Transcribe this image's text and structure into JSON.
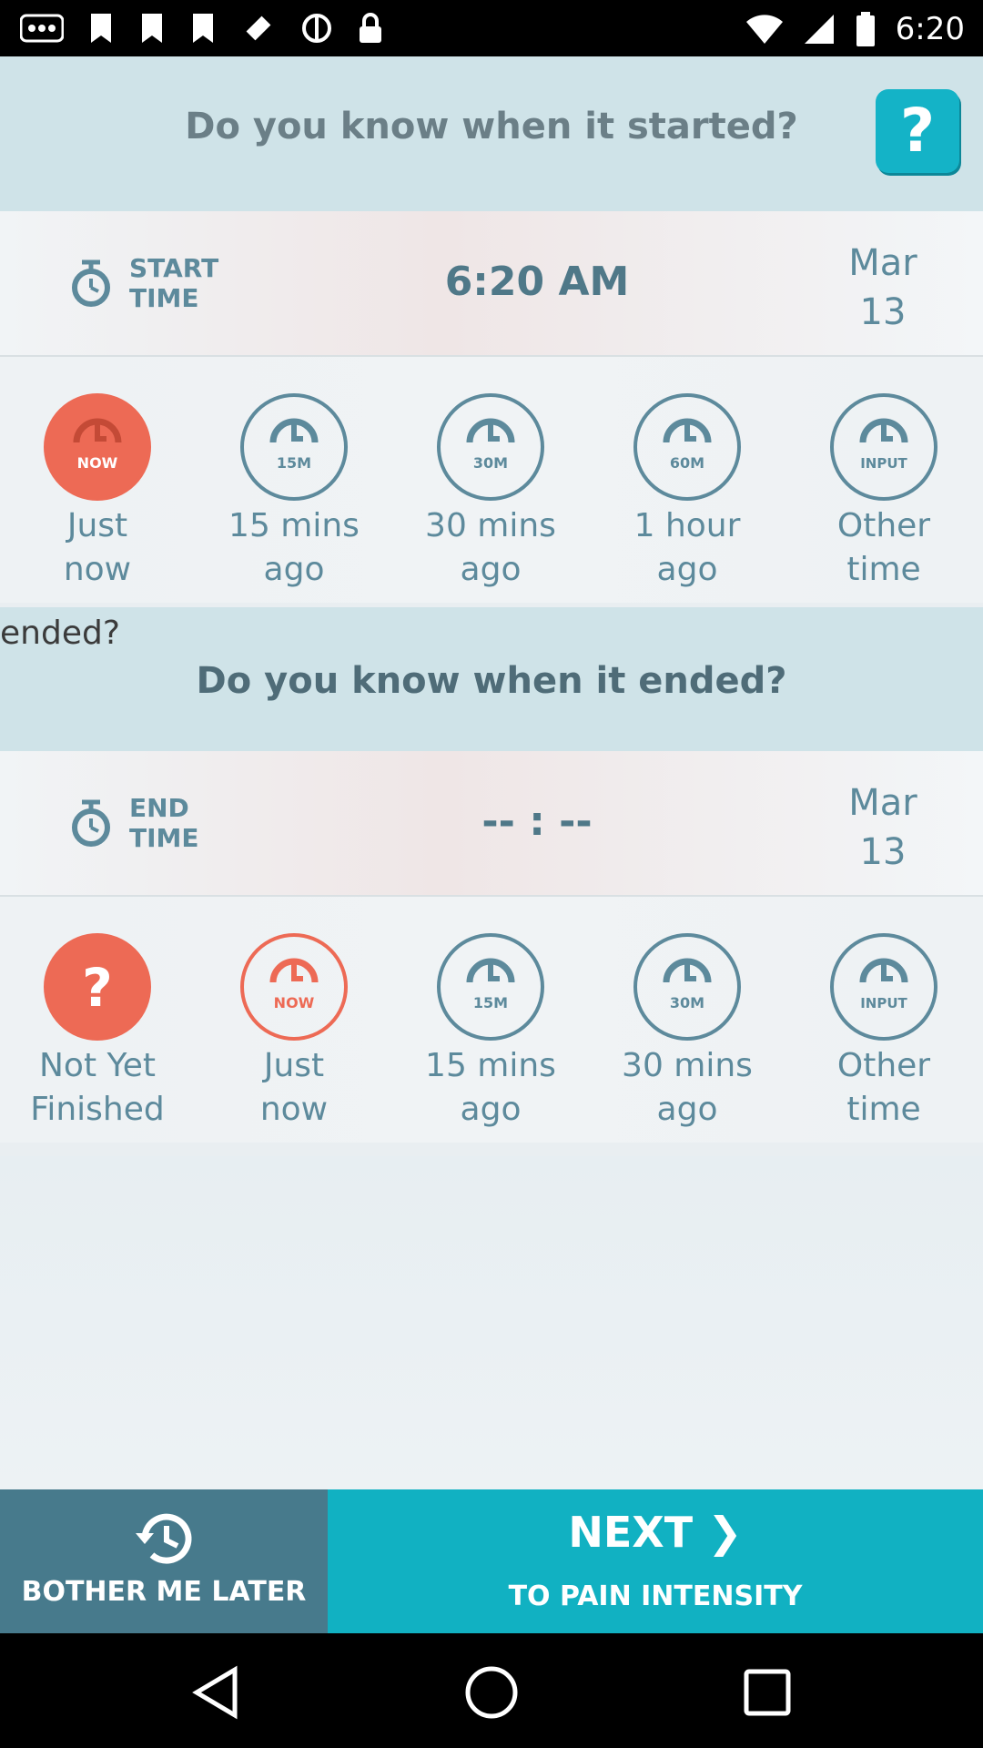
{
  "status_bar": {
    "time": "6:20"
  },
  "header": {
    "title": "Do you know when it started?",
    "help_label": "?"
  },
  "start_row": {
    "label_line1": "START",
    "label_line2": "TIME",
    "value": "6:20 AM",
    "date_month": "Mar",
    "date_day": "13"
  },
  "start_options": [
    {
      "badge": "NOW",
      "line1": "Just",
      "line2": "now"
    },
    {
      "badge": "15M",
      "line1": "15 mins",
      "line2": "ago"
    },
    {
      "badge": "30M",
      "line1": "30 mins",
      "line2": "ago"
    },
    {
      "badge": "60M",
      "line1": "1 hour",
      "line2": "ago"
    },
    {
      "badge": "INPUT",
      "line1": "Other",
      "line2": "time"
    }
  ],
  "mid": {
    "title": "Do you know when it ended?",
    "ghost": "ended?"
  },
  "end_row": {
    "label_line1": "END",
    "label_line2": "TIME",
    "value": "-- : --",
    "date_month": "Mar",
    "date_day": "13"
  },
  "end_options": [
    {
      "badge": "?",
      "line1": "Not Yet",
      "line2": "Finished"
    },
    {
      "badge": "NOW",
      "line1": "Just",
      "line2": "now"
    },
    {
      "badge": "15M",
      "line1": "15 mins",
      "line2": "ago"
    },
    {
      "badge": "30M",
      "line1": "30 mins",
      "line2": "ago"
    },
    {
      "badge": "INPUT",
      "line1": "Other",
      "line2": "time"
    }
  ],
  "bottom": {
    "later_label": "BOTHER ME LATER",
    "next_label": "NEXT",
    "next_sub": "TO PAIN INTENSITY"
  },
  "colors": {
    "accent": "#11b1c2",
    "active": "#ed6a55",
    "muted": "#5d8a9c"
  }
}
